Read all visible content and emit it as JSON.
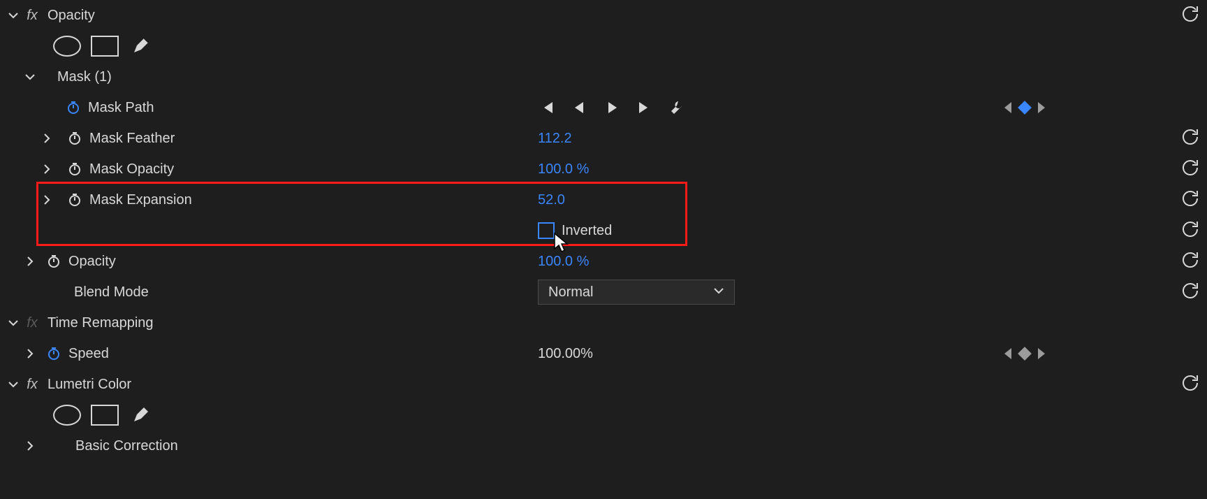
{
  "opacity_section": {
    "title": "Opacity",
    "mask": {
      "title": "Mask (1)",
      "path_label": "Mask Path",
      "feather_label": "Mask Feather",
      "feather_value": "112.2",
      "opacity_label": "Mask Opacity",
      "opacity_value": "100.0 %",
      "expansion_label": "Mask Expansion",
      "expansion_value": "52.0",
      "inverted_label": "Inverted"
    },
    "opacity_prop": {
      "label": "Opacity",
      "value": "100.0 %"
    },
    "blend_mode": {
      "label": "Blend Mode",
      "value": "Normal"
    }
  },
  "time_remapping": {
    "title": "Time Remapping",
    "speed": {
      "label": "Speed",
      "value": "100.00%"
    }
  },
  "lumetri": {
    "title": "Lumetri Color",
    "basic_correction": "Basic Correction"
  }
}
